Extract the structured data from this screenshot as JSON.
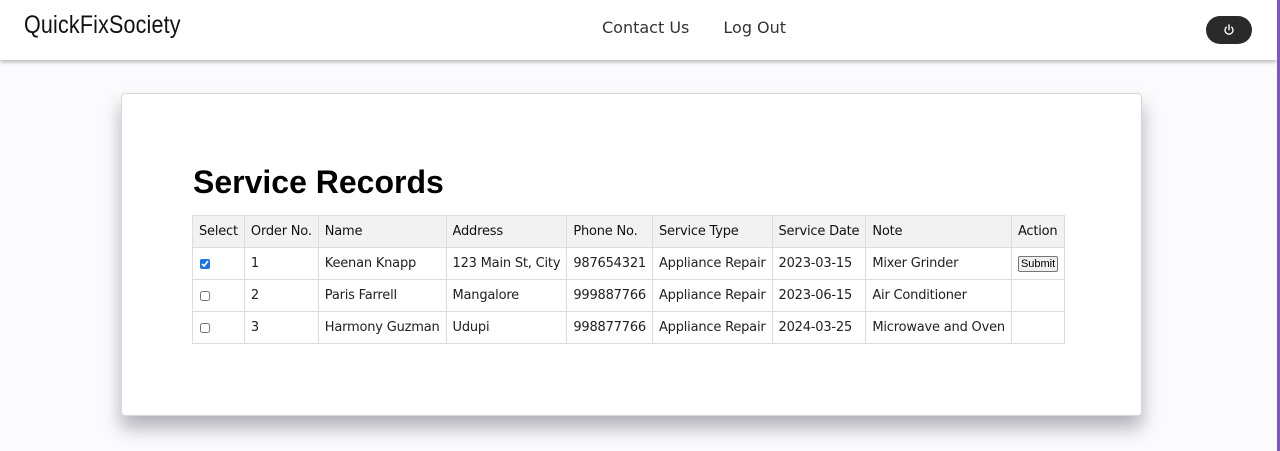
{
  "navbar": {
    "brand": "QuickFixSociety",
    "links": [
      "Contact Us",
      "Log Out"
    ],
    "power_icon": "power-icon"
  },
  "main": {
    "title": "Service Records",
    "table": {
      "headers": [
        "Select",
        "Order No.",
        "Name",
        "Address",
        "Phone No.",
        "Service Type",
        "Service Date",
        "Note",
        "Action"
      ],
      "rows": [
        {
          "selected": true,
          "order_no": "1",
          "name": "Keenan Knapp",
          "address": "123 Main St, City",
          "phone": "987654321",
          "service_type": "Appliance Repair",
          "service_date": "2023-03-15",
          "note": "Mixer Grinder",
          "action_label": "Submit"
        },
        {
          "selected": false,
          "order_no": "2",
          "name": "Paris Farrell",
          "address": "Mangalore",
          "phone": "999887766",
          "service_type": "Appliance Repair",
          "service_date": "2023-06-15",
          "note": "Air Conditioner",
          "action_label": ""
        },
        {
          "selected": false,
          "order_no": "3",
          "name": "Harmony Guzman",
          "address": "Udupi",
          "phone": "998877766",
          "service_type": "Appliance Repair",
          "service_date": "2024-03-25",
          "note": "Microwave and Oven",
          "action_label": ""
        }
      ]
    }
  },
  "colors": {
    "power_button_bg": "#2a2a2a",
    "accent_edge": "#7e57c2",
    "checkbox_checked": "#1a73e8"
  }
}
